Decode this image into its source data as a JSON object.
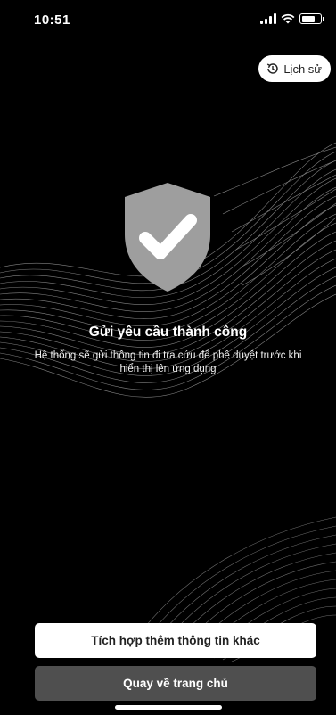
{
  "status_bar": {
    "time": "10:51"
  },
  "header": {
    "history_label": "Lịch sử",
    "history_icon": "history-clock-icon"
  },
  "result": {
    "icon": "shield-check-icon",
    "title": "Gửi yêu cầu thành công",
    "description_line1": "Hệ thống sẽ gửi thông tin đi tra cứu để phê duyệt trước khi",
    "description_line2": "hiển thị lên ứng dụng"
  },
  "actions": {
    "integrate_label": "Tích hợp thêm thông tin khác",
    "home_label": "Quay về trang chủ"
  },
  "colors": {
    "background": "#000000",
    "shield": "#9e9e9e",
    "primary_button": "#ffffff",
    "secondary_button": "#4f4f4f"
  }
}
